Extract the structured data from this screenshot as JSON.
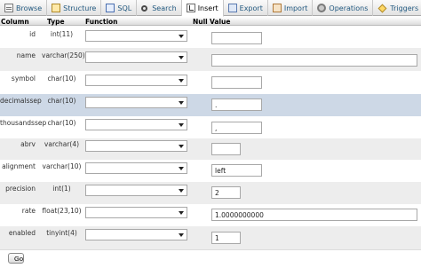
{
  "tabs": [
    {
      "label": "Browse",
      "icon": "table-browse-icon"
    },
    {
      "label": "Structure",
      "icon": "structure-icon"
    },
    {
      "label": "SQL",
      "icon": "sql-icon"
    },
    {
      "label": "Search",
      "icon": "search-icon"
    },
    {
      "label": "Insert",
      "icon": "insert-icon",
      "active": true
    },
    {
      "label": "Export",
      "icon": "export-icon"
    },
    {
      "label": "Import",
      "icon": "import-icon"
    },
    {
      "label": "Operations",
      "icon": "operations-icon"
    },
    {
      "label": "Triggers",
      "icon": "triggers-icon"
    }
  ],
  "header": {
    "column": "Column",
    "type": "Type",
    "function": "Function",
    "null": "Null",
    "value": "Value"
  },
  "rows": [
    {
      "name": "id",
      "type": "int(11)",
      "value": "",
      "style": "plain"
    },
    {
      "name": "name",
      "type": "varchar(250)",
      "value": "",
      "style": "alt"
    },
    {
      "name": "symbol",
      "type": "char(10)",
      "value": "",
      "style": "plain"
    },
    {
      "name": "decimalssep",
      "type": "char(10)",
      "value": ".",
      "style": "highlight"
    },
    {
      "name": "thousandssep",
      "type": "char(10)",
      "value": ",",
      "style": "plain"
    },
    {
      "name": "abrv",
      "type": "varchar(4)",
      "value": "",
      "style": "alt"
    },
    {
      "name": "alignment",
      "type": "varchar(10)",
      "value": "left",
      "style": "plain"
    },
    {
      "name": "precision",
      "type": "int(1)",
      "value": "2",
      "style": "alt"
    },
    {
      "name": "rate",
      "type": "float(23,10)",
      "value": "1.0000000000",
      "style": "plain"
    },
    {
      "name": "enabled",
      "type": "tinyint(4)",
      "value": "1",
      "style": "alt"
    }
  ],
  "go_label": "Go",
  "colors": {
    "tab_text": "#235a81",
    "highlight_row": "#cdd8e6",
    "alt_row": "#ededed"
  }
}
